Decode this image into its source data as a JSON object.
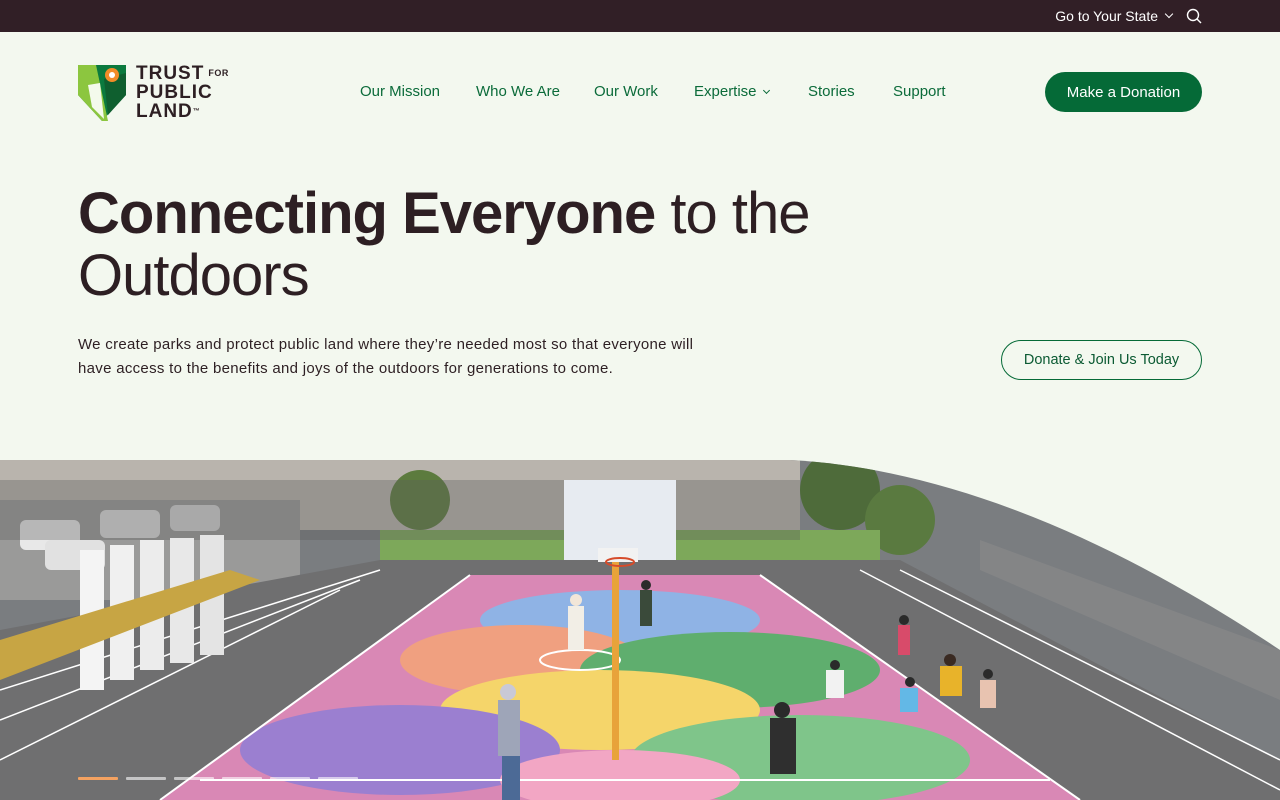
{
  "topbar": {
    "state_link": "Go to Your State",
    "search_icon": "search-icon"
  },
  "logo": {
    "line1": "TRUST",
    "for": "FOR",
    "line2": "PUBLIC",
    "line3": "LAND",
    "tm": "™"
  },
  "nav": {
    "items": [
      {
        "label": "Our Mission"
      },
      {
        "label": "Who We Are"
      },
      {
        "label": "Our Work"
      },
      {
        "label": "Expertise"
      },
      {
        "label": "Stories"
      },
      {
        "label": "Support"
      }
    ]
  },
  "header": {
    "donate_label": "Make a Donation"
  },
  "hero": {
    "title_strong": "Connecting Everyone",
    "title_rest_line1": " to the",
    "title_line2": "Outdoors",
    "description": "We create parks and protect public land where they’re needed most so that everyone will have access to the benefits and joys of the outdoors for generations to come.",
    "cta_label": "Donate & Join Us Today"
  },
  "carousel": {
    "slide_count": 6,
    "active_index": 0
  },
  "colors": {
    "topbar": "#311f26",
    "brand_green": "#056a37",
    "background": "#f3f8ef",
    "text_dark": "#2d1f23",
    "logo_orange": "#f28c28"
  }
}
